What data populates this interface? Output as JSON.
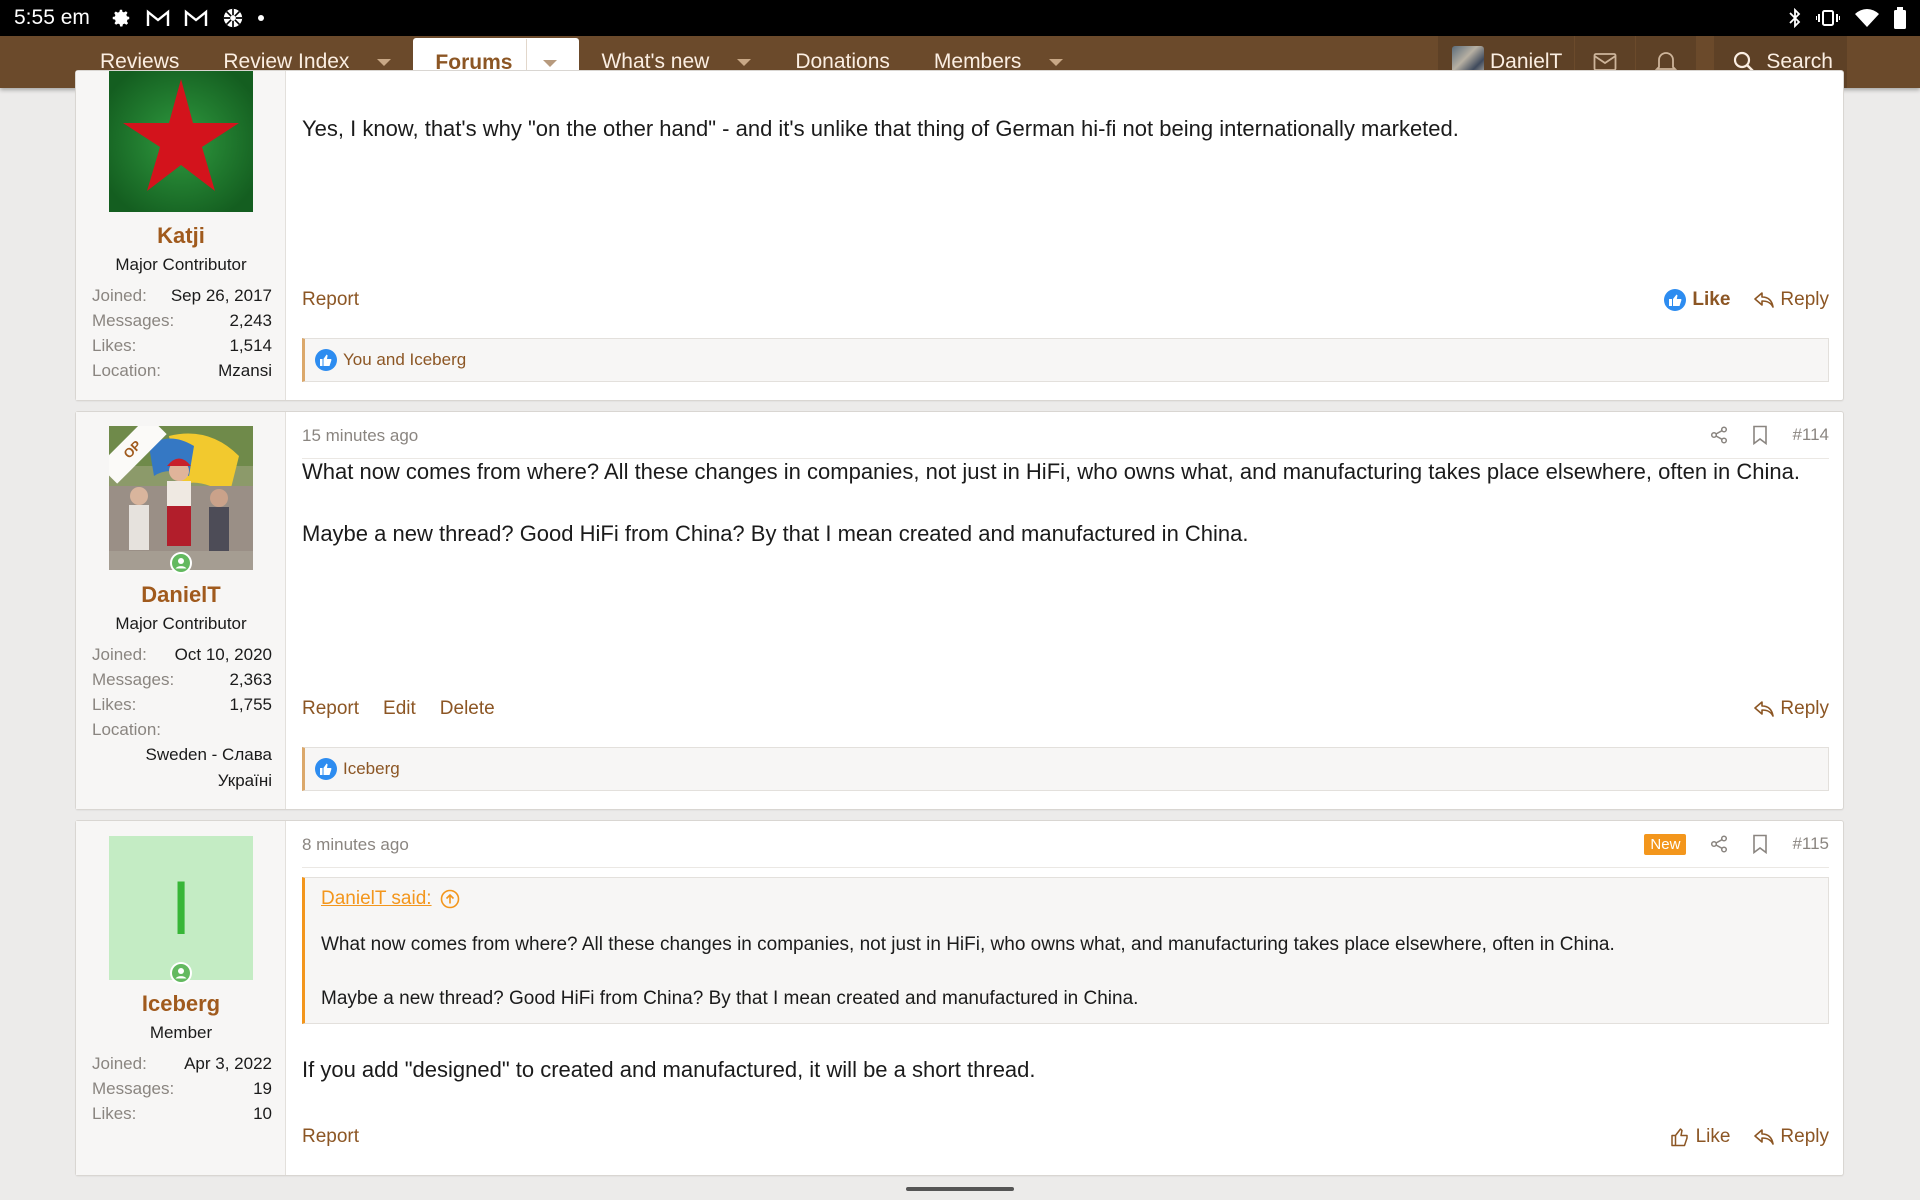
{
  "status_bar": {
    "time": "5:55 em"
  },
  "nav": {
    "tabs": [
      {
        "label": "Reviews",
        "caret": false
      },
      {
        "label": "Review Index",
        "caret": true
      },
      {
        "label": "Forums",
        "caret": true,
        "active": true
      },
      {
        "label": "What's new",
        "caret": true
      },
      {
        "label": "Donations",
        "caret": false
      },
      {
        "label": "Members",
        "caret": true
      }
    ],
    "account_name": "DanielT",
    "search_label": "Search"
  },
  "posts": [
    {
      "username": "Katji",
      "user_title": "Major Contributor",
      "stats": {
        "joined_label": "Joined:",
        "joined": "Sep 26, 2017",
        "messages_label": "Messages:",
        "messages": "2,243",
        "likes_label": "Likes:",
        "likes": "1,514",
        "location_label": "Location:",
        "location": "Mzansi"
      },
      "message": "Yes, I know, that's why \"on the other hand\" - and it's unlike that thing of German hi-fi not being internationally marketed.",
      "actions": {
        "report": "Report",
        "like": "Like",
        "reply": "Reply"
      },
      "reactions": "You and Iceberg"
    },
    {
      "op_badge": "OP",
      "time": "15 minutes ago",
      "post_number": "#114",
      "username": "DanielT",
      "user_title": "Major Contributor",
      "stats": {
        "joined_label": "Joined:",
        "joined": "Oct 10, 2020",
        "messages_label": "Messages:",
        "messages": "2,363",
        "likes_label": "Likes:",
        "likes": "1,755",
        "location_label": "Location:",
        "location_line1": "Sweden - Слава",
        "location_line2": "Україні"
      },
      "message_p1": "What now comes from where? All these changes in companies, not just in HiFi, who owns what, and manufacturing takes place elsewhere, often in China.",
      "message_p2": "Maybe a new thread? Good HiFi from China? By that I mean created and manufactured in China.",
      "actions": {
        "report": "Report",
        "edit": "Edit",
        "delete": "Delete",
        "reply": "Reply"
      },
      "reactions": "Iceberg"
    },
    {
      "time": "8 minutes ago",
      "new_badge": "New",
      "post_number": "#115",
      "avatar_letter": "I",
      "username": "Iceberg",
      "user_title": "Member",
      "stats": {
        "joined_label": "Joined:",
        "joined": "Apr 3, 2022",
        "messages_label": "Messages:",
        "messages": "19",
        "likes_label": "Likes:",
        "likes": "10"
      },
      "quote": {
        "author": "DanielT said:",
        "p1": "What now comes from where? All these changes in companies, not just in HiFi, who owns what, and manufacturing takes place elsewhere, often in China.",
        "p2": "Maybe a new thread? Good HiFi from China? By that I mean created and manufactured in China."
      },
      "message": "If you add \"designed\" to created and manufactured, it will be a short thread.",
      "actions": {
        "report": "Report",
        "like": "Like",
        "reply": "Reply"
      }
    }
  ],
  "colors": {
    "nav_bg": "#6b4a2b",
    "link": "#8c5624",
    "username": "#a05a1d",
    "quote_accent": "#f3961c",
    "like_blue": "#2d8cf0"
  }
}
